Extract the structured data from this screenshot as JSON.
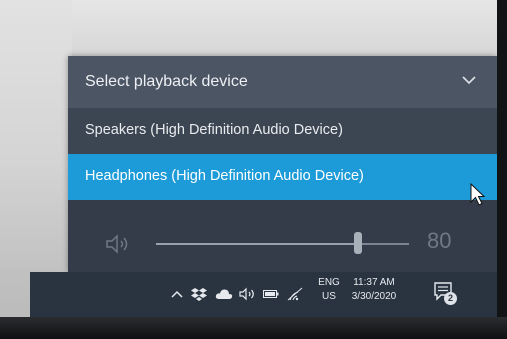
{
  "flyout": {
    "title": "Select playback device",
    "devices": [
      {
        "label": "Speakers (High Definition Audio Device)",
        "selected": false
      },
      {
        "label": "Headphones (High Definition Audio Device)",
        "selected": true
      }
    ],
    "volume": {
      "value": "80",
      "level": 0.8
    }
  },
  "taskbar": {
    "tray_icons": [
      "chevron-up-icon",
      "dropbox-icon",
      "onedrive-cloud-icon",
      "volume-icon",
      "battery-icon",
      "wifi-icon"
    ],
    "language": {
      "line1": "ENG",
      "line2": "US"
    },
    "clock": {
      "time": "11:37 AM",
      "date": "3/30/2020"
    },
    "notifications": {
      "count": "2"
    }
  },
  "colors": {
    "flyout_bg": "#2c3440",
    "header_bg": "#4b5564",
    "selected_item": "#1d9bd8",
    "taskbar_bg": "#2a3441"
  }
}
